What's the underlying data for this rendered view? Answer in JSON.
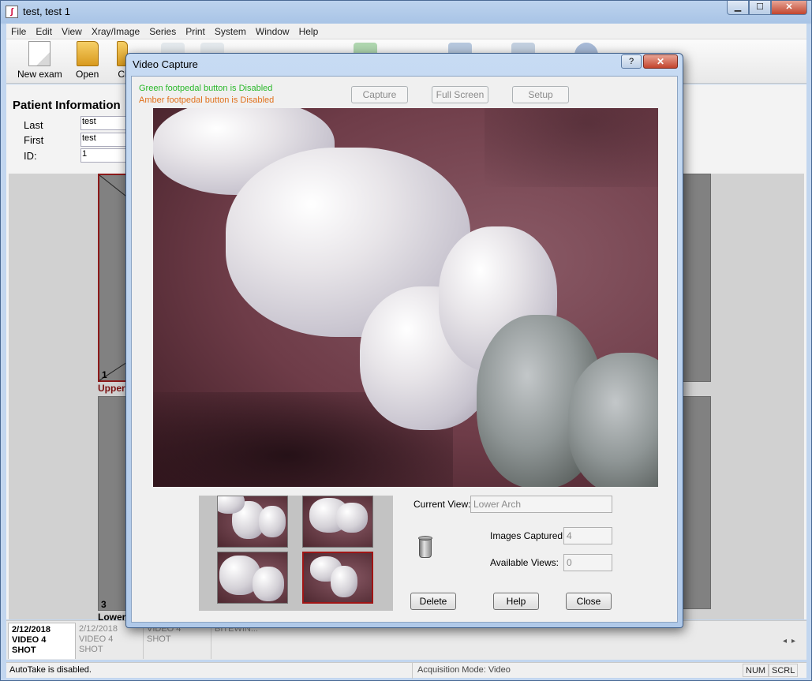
{
  "main_window": {
    "title": "test, test 1",
    "controls": {
      "minimize": "▁",
      "maximize": "☐",
      "close": "✕"
    }
  },
  "menu": [
    "File",
    "Edit",
    "View",
    "Xray/Image",
    "Series",
    "Print",
    "System",
    "Window",
    "Help"
  ],
  "toolbar": {
    "new_exam": "New exam",
    "open": "Open",
    "cl": "Cl"
  },
  "patient": {
    "heading": "Patient Information",
    "last_label": "Last",
    "last_value": "test",
    "first_label": "First",
    "first_value": "test",
    "id_label": "ID:",
    "id_value": "1"
  },
  "mount": {
    "slot1_num": "1",
    "slot1_label": "Upper",
    "slot3_num": "3",
    "slot3_label": "Lower"
  },
  "exam_tabs": [
    {
      "date": "2/12/2018",
      "name": "VIDEO 4 SHOT"
    },
    {
      "date": "2/12/2018",
      "name": "VIDEO 4 SHOT"
    },
    {
      "date": "",
      "name": "VIDEO 4 SHOT"
    },
    {
      "date": "",
      "name": "BITEWIN..."
    }
  ],
  "statusbar": {
    "autotake": "AutoTake is disabled.",
    "mode": "Acquisition Mode: Video",
    "num": "NUM",
    "scrl": "SCRL"
  },
  "dialog": {
    "title": "Video Capture",
    "help_button": "?",
    "close_x": "✕",
    "green_pedal": "Green footpedal button is Disabled",
    "amber_pedal": "Amber footpedal button is Disabled",
    "capture": "Capture",
    "full_screen": "Full Screen",
    "setup": "Setup",
    "current_view_label": "Current View:",
    "current_view_value": "Lower Arch",
    "images_captured_label": "Images Captured:",
    "images_captured_value": "4",
    "available_views_label": "Available Views:",
    "available_views_value": "0",
    "delete": "Delete",
    "help": "Help",
    "close": "Close"
  },
  "colors": {
    "green_text": "#2bb82b",
    "amber_text": "#e0701a",
    "selected_border": "#a01515"
  }
}
